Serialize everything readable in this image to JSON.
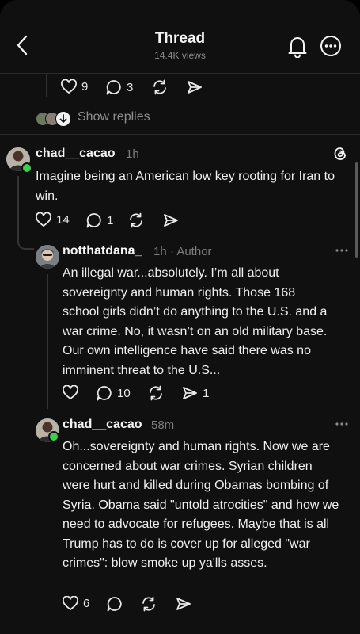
{
  "header": {
    "title": "Thread",
    "views": "14.4K views"
  },
  "top_post": {
    "likes": "9",
    "comments": "3",
    "show_replies": "Show replies"
  },
  "posts": [
    {
      "username": "chad__cacao",
      "time": "1h",
      "author_tag": "",
      "text": "Imagine being an American low key rooting for Iran to win.",
      "likes": "14",
      "comments": "1",
      "shares": ""
    },
    {
      "username": "notthatdana_",
      "time": "1h",
      "author_tag": "· Author",
      "text": "An illegal war...absolutely. I’m all about sovereignty and human rights. Those 168 school girls didn’t do anything to the U.S. and a war crime. No, it wasn’t on an old military base. Our own intelligence have said there was no imminent threat to the U.S...",
      "likes": "",
      "comments": "10",
      "shares": "1"
    },
    {
      "username": "chad__cacao",
      "time": "58m",
      "author_tag": "",
      "text": "Oh...sovereignty and human rights. Now we are concerned about war crimes. Syrian children were hurt and killed during Obamas bombing of Syria. Obama said \"untold atrocities\" and how we need to advocate for refugees. Maybe that is all Trump has to do is cover up for alleged \"war crimes\": blow smoke up ya'lls asses.",
      "likes": "6",
      "comments": "",
      "shares": ""
    }
  ],
  "icons": {
    "back": "chevron-left-icon",
    "bell": "bell-icon",
    "more": "more-circle-icon",
    "heart": "heart-icon",
    "comment": "comment-icon",
    "repost": "repost-icon",
    "share": "send-icon",
    "threads": "threads-logo-icon"
  },
  "colors": {
    "background": "#101010",
    "online": "#3ccf4e",
    "muted": "#7d7d7d"
  }
}
